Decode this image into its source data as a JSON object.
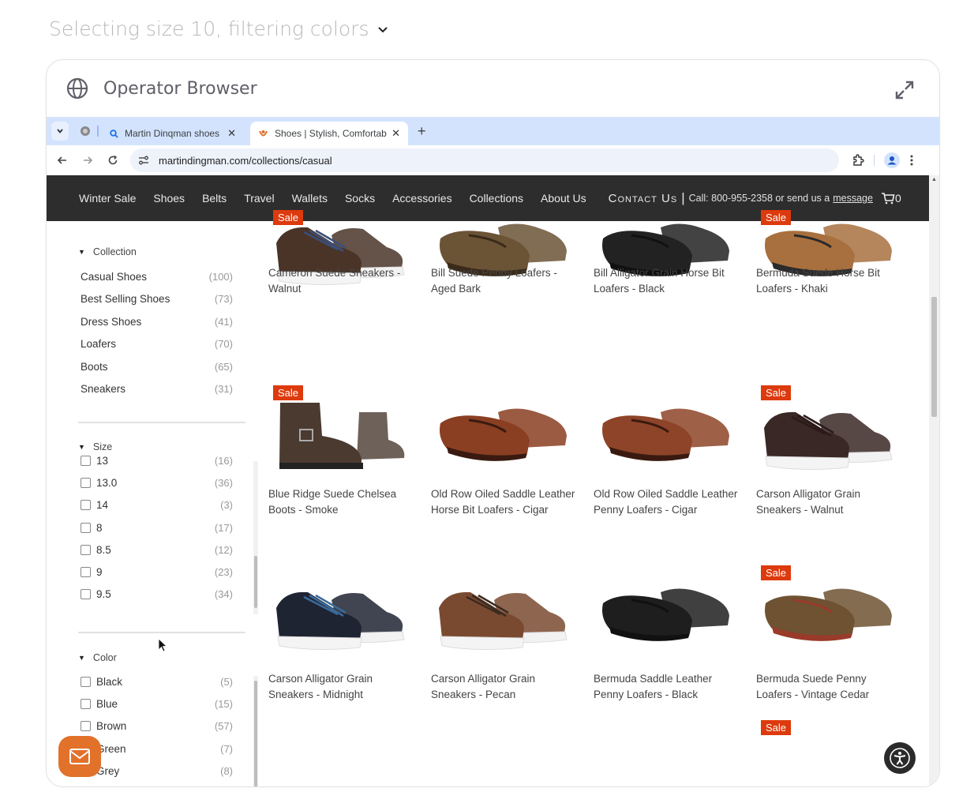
{
  "status": {
    "text": "Selecting size 10, filtering colors",
    "icon": "chevron-down-icon"
  },
  "window": {
    "title": "Operator Browser",
    "icon": "globe-icon",
    "expand_icon": "expand-icon"
  },
  "browser": {
    "tabs": [
      {
        "label": "Martin Dinqman shoes - Sea",
        "icon": "search-icon",
        "active": false
      },
      {
        "label": "Shoes | Stylish, Comfortable",
        "icon": "site-favicon",
        "active": true
      }
    ],
    "new_tab": "+",
    "url": "martindingman.com/collections/casual"
  },
  "site": {
    "nav": [
      "Winter Sale",
      "Shoes",
      "Belts",
      "Travel",
      "Wallets",
      "Socks",
      "Accessories",
      "Collections",
      "About Us"
    ],
    "contact": "Contact Us",
    "separator": "|",
    "phone_text": "Call: 800-955-2358 or send us a",
    "message_link": "message",
    "cart_count": "0",
    "accent": "#dd3a0d",
    "nav_bg": "#2d2d2d"
  },
  "filters": {
    "collection": {
      "title": "Collection",
      "items": [
        {
          "label": "Casual Shoes",
          "count": "(100)"
        },
        {
          "label": "Best Selling Shoes",
          "count": "(73)"
        },
        {
          "label": "Dress Shoes",
          "count": "(41)"
        },
        {
          "label": "Loafers",
          "count": "(70)"
        },
        {
          "label": "Boots",
          "count": "(65)"
        },
        {
          "label": "Sneakers",
          "count": "(31)"
        }
      ]
    },
    "size": {
      "title": "Size",
      "items": [
        {
          "label": "13",
          "count": "(16)"
        },
        {
          "label": "13.0",
          "count": "(36)"
        },
        {
          "label": "14",
          "count": "(3)"
        },
        {
          "label": "8",
          "count": "(17)"
        },
        {
          "label": "8.5",
          "count": "(12)"
        },
        {
          "label": "9",
          "count": "(23)"
        },
        {
          "label": "9.5",
          "count": "(34)"
        }
      ]
    },
    "color": {
      "title": "Color",
      "items": [
        {
          "label": "Black",
          "count": "(5)"
        },
        {
          "label": "Blue",
          "count": "(15)"
        },
        {
          "label": "Brown",
          "count": "(57)"
        },
        {
          "label": "Green",
          "count": "(7)"
        },
        {
          "label": "Grey",
          "count": "(8)"
        }
      ]
    }
  },
  "products": [
    {
      "name": "Cameron Suede Sneakers - Walnut",
      "sale": true,
      "sale_label": "Sale",
      "type": "sneaker",
      "color": "#4a3428",
      "accent": "#3a4f7a"
    },
    {
      "name": "Bill Suede Penny Loafers - Aged Bark",
      "sale": false,
      "type": "loafer",
      "color": "#6b5335",
      "accent": "#3a2a1a"
    },
    {
      "name": "Bill Alligator Grain Horse Bit Loafers - Black",
      "sale": false,
      "type": "loafer",
      "color": "#222222",
      "accent": "#111111"
    },
    {
      "name": "Bermuda Suede Horse Bit Loafers - Khaki",
      "sale": true,
      "sale_label": "Sale",
      "type": "loafer",
      "color": "#a8703e",
      "accent": "#2a2a2a"
    },
    {
      "name": "Blue Ridge Suede Chelsea Boots - Smoke",
      "sale": true,
      "sale_label": "Sale",
      "type": "boot",
      "color": "#4a3a30",
      "accent": "#222222"
    },
    {
      "name": "Old Row Oiled Saddle Leather Horse Bit Loafers - Cigar",
      "sale": false,
      "type": "loafer",
      "color": "#8a3e22",
      "accent": "#3a1a10"
    },
    {
      "name": "Old Row Oiled Saddle Leather Penny Loafers - Cigar",
      "sale": false,
      "type": "loafer",
      "color": "#8e4428",
      "accent": "#3a1a10"
    },
    {
      "name": "Carson Alligator Grain Sneakers - Walnut",
      "sale": true,
      "sale_label": "Sale",
      "type": "sneaker",
      "color": "#3a2826",
      "accent": "#2a1a18"
    },
    {
      "name": "Carson Alligator Grain Sneakers - Midnight",
      "sale": false,
      "type": "sneaker",
      "color": "#1f2433",
      "accent": "#3a6a9a"
    },
    {
      "name": "Carson Alligator Grain Sneakers - Pecan",
      "sale": false,
      "type": "sneaker",
      "color": "#7a4a30",
      "accent": "#3a2a20"
    },
    {
      "name": "Bermuda Saddle Leather Penny Loafers - Black",
      "sale": false,
      "type": "loafer",
      "color": "#1e1e1e",
      "accent": "#111111"
    },
    {
      "name": "Bermuda Suede Penny Loafers - Vintage Cedar",
      "sale": true,
      "sale_label": "Sale",
      "type": "loafer",
      "color": "#6e5232",
      "accent": "#9a3a2a"
    }
  ],
  "next_row_sale_label": "Sale",
  "widgets": {
    "chat": "mail-icon",
    "accessibility": "accessibility-icon"
  }
}
